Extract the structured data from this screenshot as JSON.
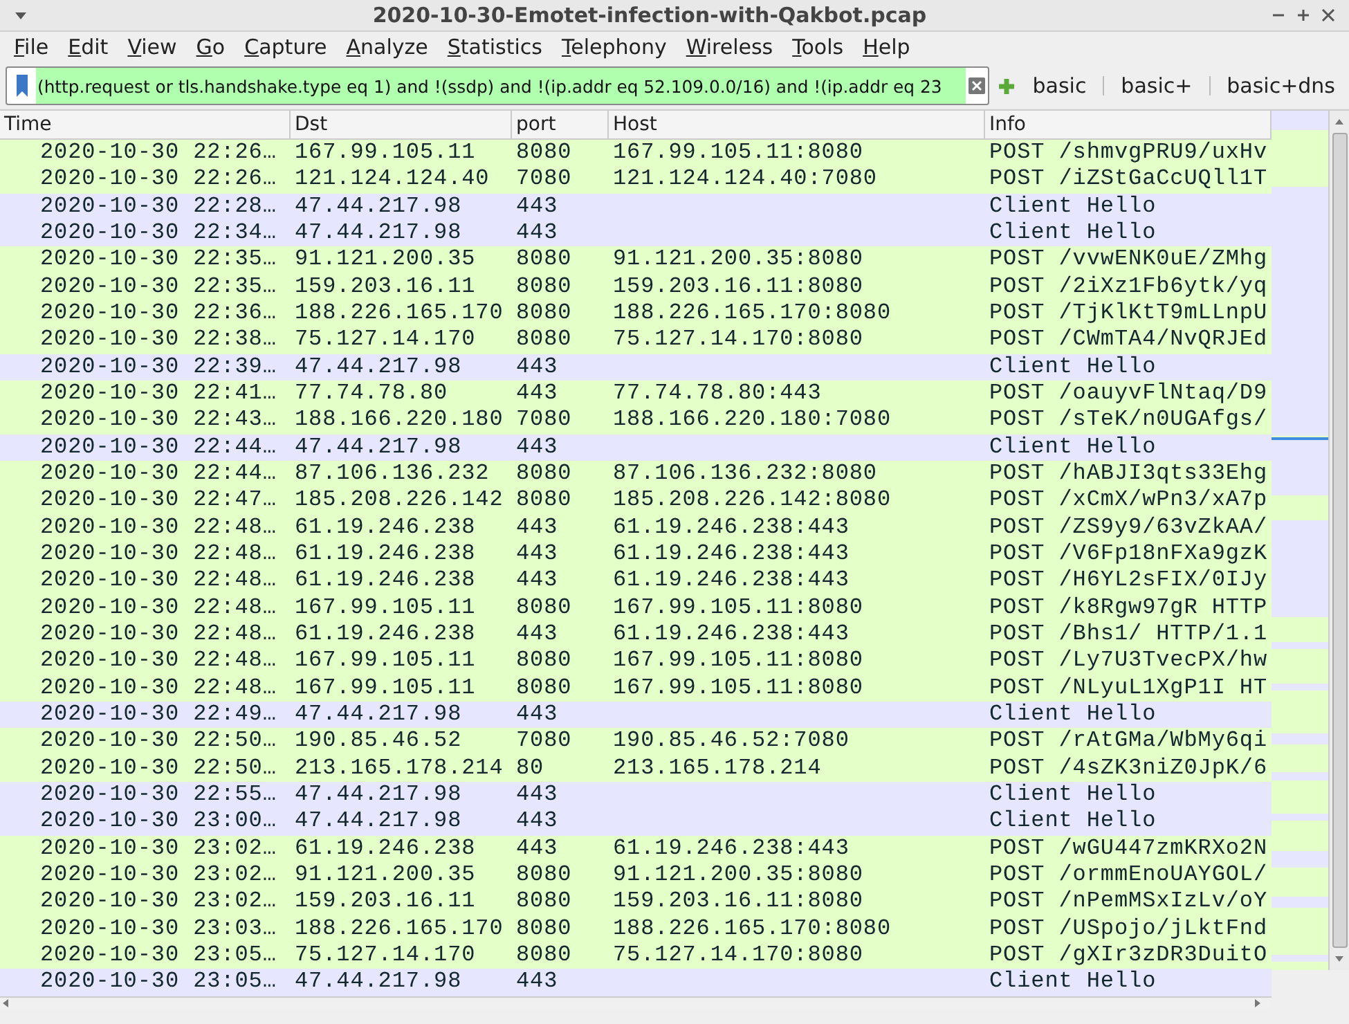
{
  "window": {
    "title": "2020-10-30-Emotet-infection-with-Qakbot.pcap"
  },
  "menu": [
    "File",
    "Edit",
    "View",
    "Go",
    "Capture",
    "Analyze",
    "Statistics",
    "Telephony",
    "Wireless",
    "Tools",
    "Help"
  ],
  "filter": {
    "value": "(http.request or tls.handshake.type eq 1) and !(ssdp) and !(ip.addr eq 52.109.0.0/16) and !(ip.addr eq 23",
    "valid": true
  },
  "filter_buttons": [
    "basic",
    "basic+",
    "basic+dns"
  ],
  "table": {
    "columns": [
      "Time",
      "Dst",
      "port",
      "Host",
      "Info"
    ],
    "rows": [
      {
        "kind": "http",
        "cells": [
          "2020-10-30 22:26…",
          "167.99.105.11",
          "8080",
          "167.99.105.11:8080",
          "POST /shmvgPRU9/uxHv"
        ]
      },
      {
        "kind": "http",
        "cells": [
          "2020-10-30 22:26…",
          "121.124.124.40",
          "7080",
          "121.124.124.40:7080",
          "POST /iZStGaCcUQll1T"
        ]
      },
      {
        "kind": "tls",
        "cells": [
          "2020-10-30 22:28…",
          "47.44.217.98",
          "443",
          "",
          "Client Hello"
        ]
      },
      {
        "kind": "tls",
        "cells": [
          "2020-10-30 22:34…",
          "47.44.217.98",
          "443",
          "",
          "Client Hello"
        ]
      },
      {
        "kind": "http",
        "cells": [
          "2020-10-30 22:35…",
          "91.121.200.35",
          "8080",
          "91.121.200.35:8080",
          "POST /vvwENK0uE/ZMhg"
        ]
      },
      {
        "kind": "http",
        "cells": [
          "2020-10-30 22:35…",
          "159.203.16.11",
          "8080",
          "159.203.16.11:8080",
          "POST /2iXz1Fb6ytk/yq"
        ]
      },
      {
        "kind": "http",
        "cells": [
          "2020-10-30 22:36…",
          "188.226.165.170",
          "8080",
          "188.226.165.170:8080",
          "POST /TjKlKtT9mLLnpU"
        ]
      },
      {
        "kind": "http",
        "cells": [
          "2020-10-30 22:38…",
          "75.127.14.170",
          "8080",
          "75.127.14.170:8080",
          "POST /CWmTA4/NvQRJEd"
        ]
      },
      {
        "kind": "tls",
        "cells": [
          "2020-10-30 22:39…",
          "47.44.217.98",
          "443",
          "",
          "Client Hello"
        ]
      },
      {
        "kind": "http",
        "cells": [
          "2020-10-30 22:41…",
          "77.74.78.80",
          "443",
          "77.74.78.80:443",
          "POST /oauyvFlNtaq/D9"
        ]
      },
      {
        "kind": "http",
        "cells": [
          "2020-10-30 22:43…",
          "188.166.220.180",
          "7080",
          "188.166.220.180:7080",
          "POST /sTeK/n0UGAfgs/"
        ]
      },
      {
        "kind": "tls",
        "cells": [
          "2020-10-30 22:44…",
          "47.44.217.98",
          "443",
          "",
          "Client Hello"
        ]
      },
      {
        "kind": "http",
        "cells": [
          "2020-10-30 22:44…",
          "87.106.136.232",
          "8080",
          "87.106.136.232:8080",
          "POST /hABJI3qts33Ehg"
        ]
      },
      {
        "kind": "http",
        "cells": [
          "2020-10-30 22:47…",
          "185.208.226.142",
          "8080",
          "185.208.226.142:8080",
          "POST /xCmX/wPn3/xA7p"
        ]
      },
      {
        "kind": "http",
        "cells": [
          "2020-10-30 22:48…",
          "61.19.246.238",
          "443",
          "61.19.246.238:443",
          "POST /ZS9y9/63vZkAA/"
        ]
      },
      {
        "kind": "http",
        "cells": [
          "2020-10-30 22:48…",
          "61.19.246.238",
          "443",
          "61.19.246.238:443",
          "POST /V6Fp18nFXa9gzK"
        ]
      },
      {
        "kind": "http",
        "cells": [
          "2020-10-30 22:48…",
          "61.19.246.238",
          "443",
          "61.19.246.238:443",
          "POST /H6YL2sFIX/0IJy"
        ]
      },
      {
        "kind": "http",
        "cells": [
          "2020-10-30 22:48…",
          "167.99.105.11",
          "8080",
          "167.99.105.11:8080",
          "POST /k8Rgw97gR HTTP"
        ]
      },
      {
        "kind": "http",
        "cells": [
          "2020-10-30 22:48…",
          "61.19.246.238",
          "443",
          "61.19.246.238:443",
          "POST /Bhs1/ HTTP/1.1"
        ]
      },
      {
        "kind": "http",
        "cells": [
          "2020-10-30 22:48…",
          "167.99.105.11",
          "8080",
          "167.99.105.11:8080",
          "POST /Ly7U3TvecPX/hw"
        ]
      },
      {
        "kind": "http",
        "cells": [
          "2020-10-30 22:48…",
          "167.99.105.11",
          "8080",
          "167.99.105.11:8080",
          "POST /NLyuL1XgP1I HT"
        ]
      },
      {
        "kind": "tls",
        "cells": [
          "2020-10-30 22:49…",
          "47.44.217.98",
          "443",
          "",
          "Client Hello"
        ]
      },
      {
        "kind": "http",
        "cells": [
          "2020-10-30 22:50…",
          "190.85.46.52",
          "7080",
          "190.85.46.52:7080",
          "POST /rAtGMa/WbMy6qi"
        ]
      },
      {
        "kind": "http",
        "cells": [
          "2020-10-30 22:50…",
          "213.165.178.214",
          "80",
          "213.165.178.214",
          "POST /4sZK3niZ0JpK/6"
        ]
      },
      {
        "kind": "tls",
        "cells": [
          "2020-10-30 22:55…",
          "47.44.217.98",
          "443",
          "",
          "Client Hello"
        ]
      },
      {
        "kind": "tls",
        "cells": [
          "2020-10-30 23:00…",
          "47.44.217.98",
          "443",
          "",
          "Client Hello"
        ]
      },
      {
        "kind": "http",
        "cells": [
          "2020-10-30 23:02…",
          "61.19.246.238",
          "443",
          "61.19.246.238:443",
          "POST /wGU447zmKRXo2N"
        ]
      },
      {
        "kind": "http",
        "cells": [
          "2020-10-30 23:02…",
          "91.121.200.35",
          "8080",
          "91.121.200.35:8080",
          "POST /ormmEnoUAYGOL/"
        ]
      },
      {
        "kind": "http",
        "cells": [
          "2020-10-30 23:02…",
          "159.203.16.11",
          "8080",
          "159.203.16.11:8080",
          "POST /nPemMSxIzLv/oY"
        ]
      },
      {
        "kind": "http",
        "cells": [
          "2020-10-30 23:03…",
          "188.226.165.170",
          "8080",
          "188.226.165.170:8080",
          "POST /USpojo/jLktFnd"
        ]
      },
      {
        "kind": "http",
        "cells": [
          "2020-10-30 23:05…",
          "75.127.14.170",
          "8080",
          "75.127.14.170:8080",
          "POST /gXIr3zDR3DuitO"
        ]
      },
      {
        "kind": "tls",
        "cells": [
          "2020-10-30 23:05…",
          "47.44.217.98",
          "443",
          "",
          "Client Hello"
        ]
      }
    ]
  }
}
